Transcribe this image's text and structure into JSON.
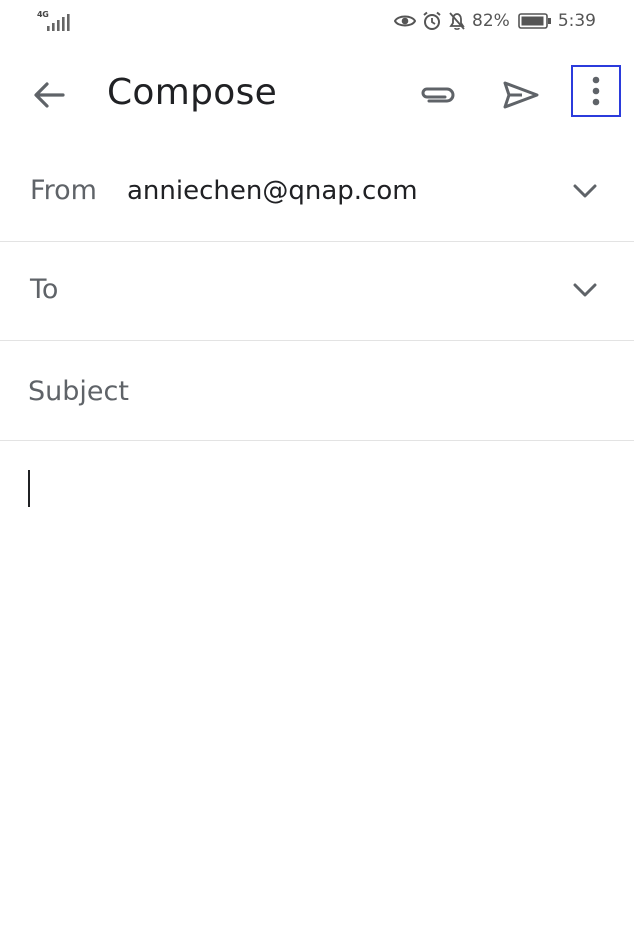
{
  "status_bar": {
    "network": "4G",
    "battery_percent": "82%",
    "time": "5:39",
    "icons": [
      "signal-icon",
      "eye-icon",
      "alarm-icon",
      "notifications-off-icon",
      "battery-icon"
    ]
  },
  "app_bar": {
    "title": "Compose",
    "icons": [
      "back-arrow-icon",
      "attach-icon",
      "send-icon",
      "more-vert-icon"
    ]
  },
  "fields": {
    "from_label": "From",
    "from_value": "anniechen@qnap.com",
    "to_label": "To",
    "subject_placeholder": "Subject"
  },
  "colors": {
    "icon": "#5f6368",
    "text": "#202124",
    "divider": "#e3e3e3",
    "highlight": "#2b3bdc"
  }
}
